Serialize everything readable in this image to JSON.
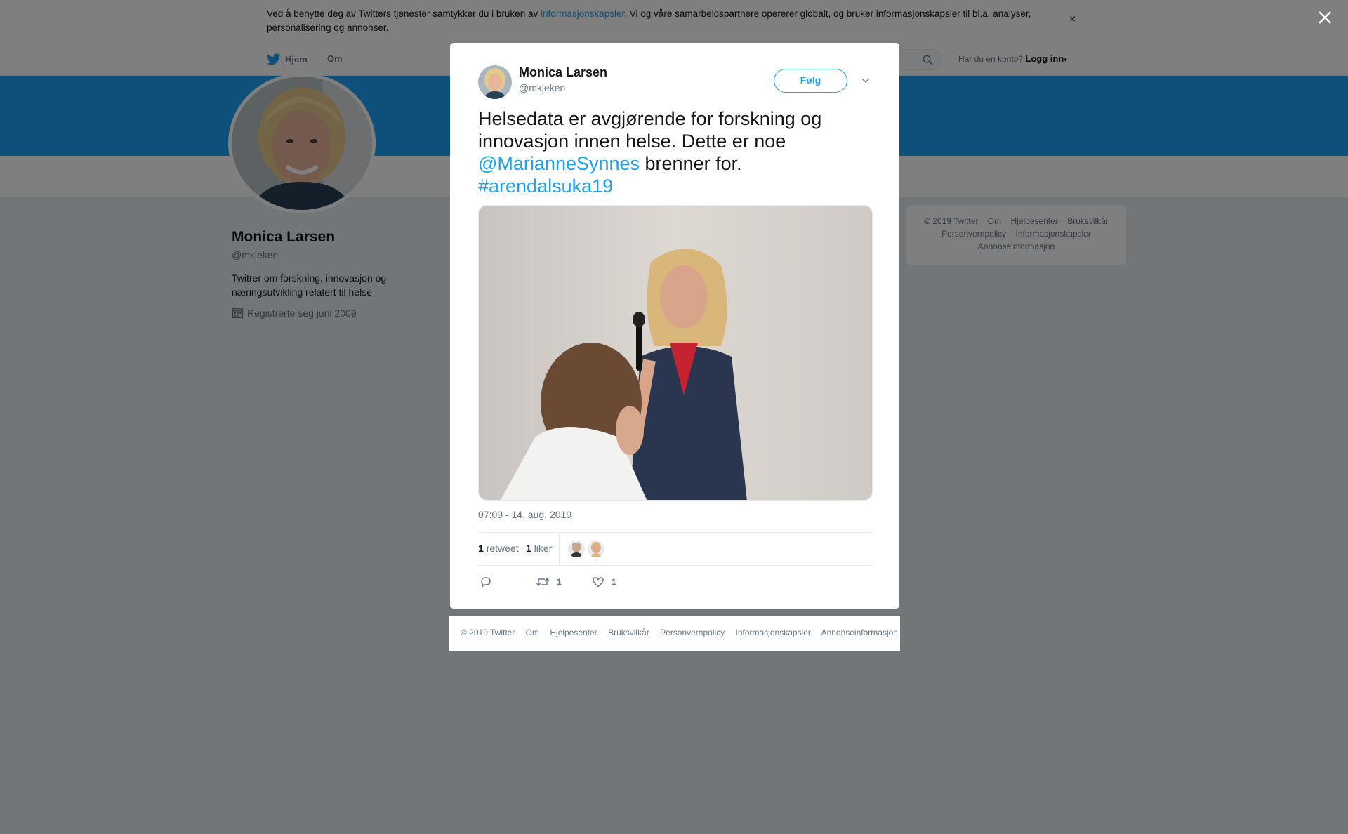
{
  "cookie_notice": {
    "text_before": "Ved å benytte deg av Twitters tjenester samtykker du i bruken av ",
    "link": "informasjonskapsler",
    "text_after": ". Vi og våre samarbeidspartnere opererer globalt, og bruker informasjonskapsler til bl.a. analyser, personalisering og annonser.",
    "close": "×"
  },
  "topnav": {
    "home": "Hjem",
    "about": "Om",
    "account_prompt": "Har du en konto?",
    "login": "Logg inn"
  },
  "profile": {
    "name": "Monica Larsen",
    "handle": "@mkjeken",
    "bio": "Twitrer om forskning, innovasjon og næringsutvikling relatert til helse",
    "joined": "Registrerte seg juni 2009"
  },
  "right_footer": [
    "© 2019 Twitter",
    "Om",
    "Hjelpesenter",
    "Bruksvilkår",
    "Personvernpolicy",
    "Informasjonskapsler",
    "Annonseinformasjon"
  ],
  "tweet": {
    "author_name": "Monica Larsen",
    "author_handle": "@mkjeken",
    "follow": "Følg",
    "text_part1": "Helsedata er avgjørende for forskning og innovasjon innen helse. Dette er noe ",
    "mention": "@MarianneSynnes",
    "text_part2": " brenner for.",
    "hashtag": "#arendalsuka19",
    "timestamp": "07:09 - 14. aug. 2019",
    "retweets_count": "1",
    "retweets_label": "retweet",
    "likes_count": "1",
    "likes_label": "liker",
    "action_retweet_count": "1",
    "action_like_count": "1"
  },
  "modal_footer": [
    "© 2019 Twitter",
    "Om",
    "Hjelpesenter",
    "Bruksvilkår",
    "Personvernpolicy",
    "Informasjonskapsler",
    "Annonseinformasjon"
  ],
  "colors": {
    "accent": "#1da1f2",
    "banner": "#1da1f2",
    "overlay": "#737a80"
  },
  "icons": [
    "twitter-bird-icon",
    "search-icon",
    "caret-down-icon",
    "calendar-icon",
    "close-icon",
    "chevron-down-icon",
    "reply-icon",
    "retweet-icon",
    "heart-icon"
  ]
}
